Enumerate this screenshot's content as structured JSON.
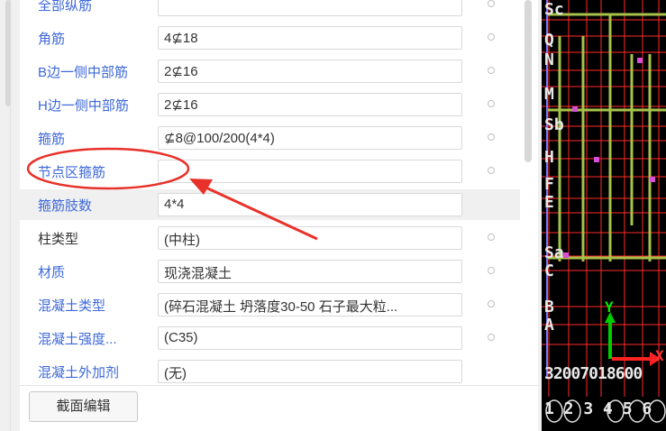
{
  "properties": [
    {
      "name": "全部纵筋",
      "value": "",
      "color": "blue"
    },
    {
      "name": "角筋",
      "value": "4⊈18",
      "color": "blue"
    },
    {
      "name": "B边一侧中部筋",
      "value": "2⊈16",
      "color": "blue"
    },
    {
      "name": "H边一侧中部筋",
      "value": "2⊈16",
      "color": "blue"
    },
    {
      "name": "箍筋",
      "value": "⊈8@100/200(4*4)",
      "color": "blue"
    },
    {
      "name": "节点区箍筋",
      "value": "",
      "color": "blue"
    },
    {
      "name": "箍筋肢数",
      "value": "4*4",
      "color": "blue",
      "highlight": true,
      "no_dot": true
    },
    {
      "name": "柱类型",
      "value": "(中柱)",
      "color": "dark"
    },
    {
      "name": "材质",
      "value": "现浇混凝土",
      "color": "blue"
    },
    {
      "name": "混凝土类型",
      "value": "(碎石混凝土 坍落度30-50 石子最大粒...",
      "color": "blue"
    },
    {
      "name": "混凝土强度...",
      "value": "(C35)",
      "color": "blue"
    },
    {
      "name": "混凝土外加剂",
      "value": "(无)",
      "color": "blue",
      "no_dot": true
    }
  ],
  "buttons": {
    "section_edit": "截面编辑"
  },
  "cad": {
    "labels": [
      "Sc",
      "Q",
      "N",
      "M",
      "Sb",
      "H",
      "F",
      "E",
      "Sa",
      "C",
      "B",
      "A"
    ],
    "axis_y": "Y",
    "axis_x": "X",
    "bottom_numbers": "32007018600",
    "bottom_circles": "1 2 3 4 5 6"
  },
  "annotation_color": "#e8312a"
}
